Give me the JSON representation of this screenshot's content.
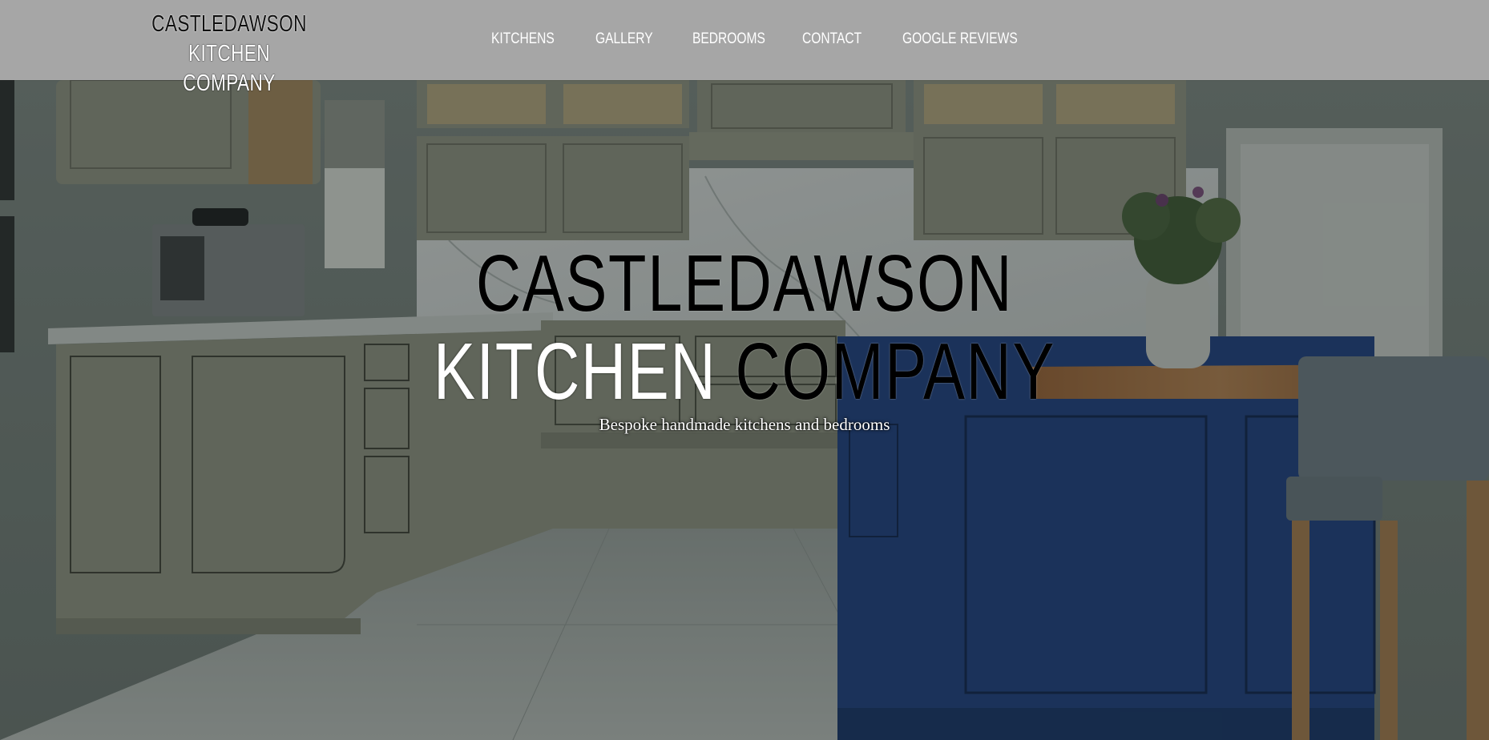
{
  "brand": {
    "line1": "CASTLEDAWSON",
    "line2": "KITCHEN COMPANY"
  },
  "nav": {
    "items": [
      {
        "label": "KITCHENS"
      },
      {
        "label": "GALLERY"
      },
      {
        "label": "BEDROOMS"
      },
      {
        "label": "CONTACT"
      },
      {
        "label": "GOOGLE REVIEWS"
      }
    ]
  },
  "hero": {
    "title_line1": "CASTLEDAWSON",
    "title_line2_part1": "KITCHEN",
    "title_line2_part2": "COMPANY",
    "subtitle": "Bespoke handmade kitchens and bedrooms"
  },
  "colors": {
    "header_bg": "#a6a6a6",
    "cabinet_sage": "#8e9180",
    "island_blue": "#1f3f80",
    "worktop_wood": "#a26a3d"
  }
}
